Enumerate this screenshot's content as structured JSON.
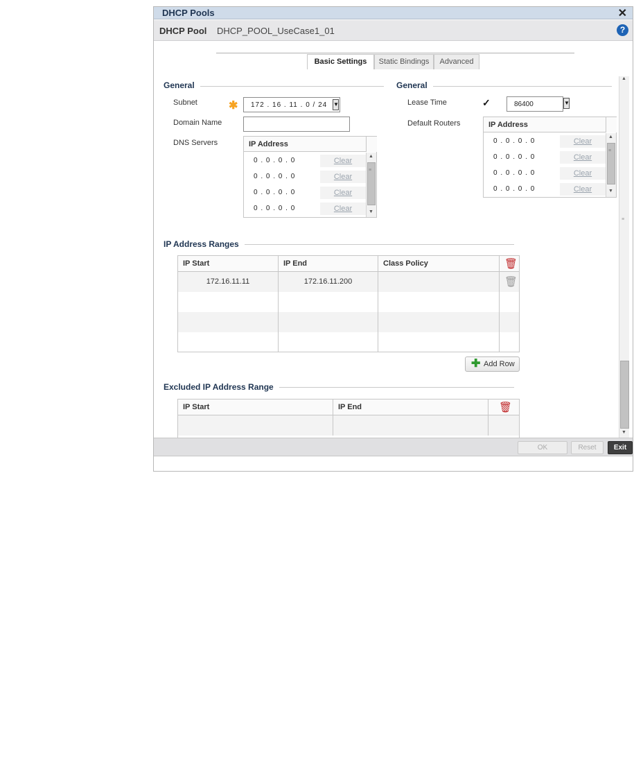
{
  "window": {
    "title": "DHCP Pools",
    "close_glyph": "✕"
  },
  "header": {
    "label": "DHCP Pool",
    "value": "DHCP_POOL_UseCase1_01",
    "help_glyph": "?"
  },
  "tabs": [
    {
      "label": "Basic Settings",
      "active": true
    },
    {
      "label": "Static Bindings",
      "active": false
    },
    {
      "label": "Advanced",
      "active": false
    }
  ],
  "general_left": {
    "title": "General",
    "subnet": {
      "label": "Subnet",
      "value": "172 . 16 . 11 . 0 / 24",
      "required_mark": "✱"
    },
    "domain_name": {
      "label": "Domain Name",
      "value": ""
    },
    "dns_servers": {
      "label": "DNS Servers",
      "column": "IP Address",
      "rows": [
        {
          "ip": "0 . 0 . 0 . 0",
          "action": "Clear"
        },
        {
          "ip": "0 . 0 . 0 . 0",
          "action": "Clear"
        },
        {
          "ip": "0 . 0 . 0 . 0",
          "action": "Clear"
        },
        {
          "ip": "0 . 0 . 0 . 0",
          "action": "Clear"
        }
      ]
    }
  },
  "general_right": {
    "title": "General",
    "lease_time": {
      "label": "Lease Time",
      "checked": true,
      "check_glyph": "✓",
      "value": "86400"
    },
    "default_routers": {
      "label": "Default Routers",
      "column": "IP Address",
      "rows": [
        {
          "ip": "0 . 0 . 0 . 0",
          "action": "Clear"
        },
        {
          "ip": "0 . 0 . 0 . 0",
          "action": "Clear"
        },
        {
          "ip": "0 . 0 . 0 . 0",
          "action": "Clear"
        },
        {
          "ip": "0 . 0 . 0 . 0",
          "action": "Clear"
        }
      ]
    }
  },
  "ip_ranges": {
    "title": "IP Address Ranges",
    "columns": [
      "IP Start",
      "IP End",
      "Class Policy"
    ],
    "rows": [
      {
        "start": "172.16.11.11",
        "end": "172.16.11.200",
        "class_policy": ""
      }
    ],
    "add_row_label": "Add Row",
    "add_glyph": "✚"
  },
  "excluded": {
    "title": "Excluded IP Address Range",
    "columns": [
      "IP Start",
      "IP End"
    ]
  },
  "footer": {
    "ok": "OK",
    "reset": "Reset",
    "exit": "Exit"
  },
  "colors": {
    "accent": "#1f3552",
    "required": "#f7a321",
    "delete": "#c0282a",
    "add": "#2f9a2f",
    "help": "#1e63b5"
  }
}
